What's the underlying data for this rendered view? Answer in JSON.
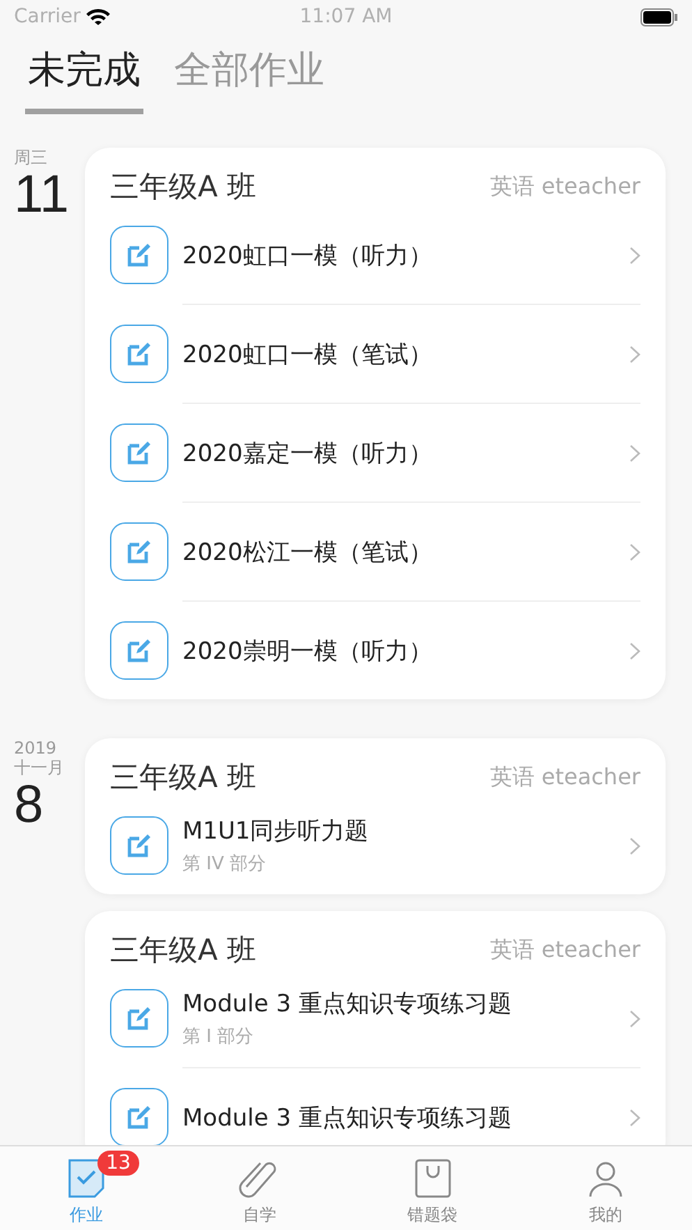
{
  "status_bar": {
    "carrier": "Carrier",
    "time": "11:07 AM"
  },
  "tabs": [
    {
      "label": "未完成",
      "selected": true
    },
    {
      "label": "全部作业",
      "selected": false
    }
  ],
  "groups": [
    {
      "date": {
        "top": "周三",
        "number": "11"
      },
      "cards": [
        {
          "class_name": "三年级A 班",
          "subject": "英语 eteacher",
          "items": [
            {
              "title": "2020虹口一模（听力）"
            },
            {
              "title": "2020虹口一模（笔试）"
            },
            {
              "title": "2020嘉定一模（听力）"
            },
            {
              "title": "2020松江一模（笔试）"
            },
            {
              "title": "2020崇明一模（听力）"
            }
          ]
        }
      ]
    },
    {
      "date": {
        "year": "2019",
        "top": "十一月",
        "number": "8"
      },
      "cards": [
        {
          "class_name": "三年级A 班",
          "subject": "英语 eteacher",
          "items": [
            {
              "title": "M1U1同步听力题",
              "subtitle": "第 IV 部分"
            }
          ]
        },
        {
          "class_name": "三年级A 班",
          "subject": "英语 eteacher",
          "items": [
            {
              "title": "Module 3 重点知识专项练习题",
              "subtitle": "第 I 部分"
            },
            {
              "title": "Module 3 重点知识专项练习题"
            }
          ]
        }
      ]
    }
  ],
  "bottom_tabs": [
    {
      "label": "作业",
      "kind": "homework",
      "selected": true,
      "badge": "13"
    },
    {
      "label": "自学",
      "kind": "study",
      "selected": false
    },
    {
      "label": "错题袋",
      "kind": "bag",
      "selected": false
    },
    {
      "label": "我的",
      "kind": "me",
      "selected": false
    }
  ]
}
